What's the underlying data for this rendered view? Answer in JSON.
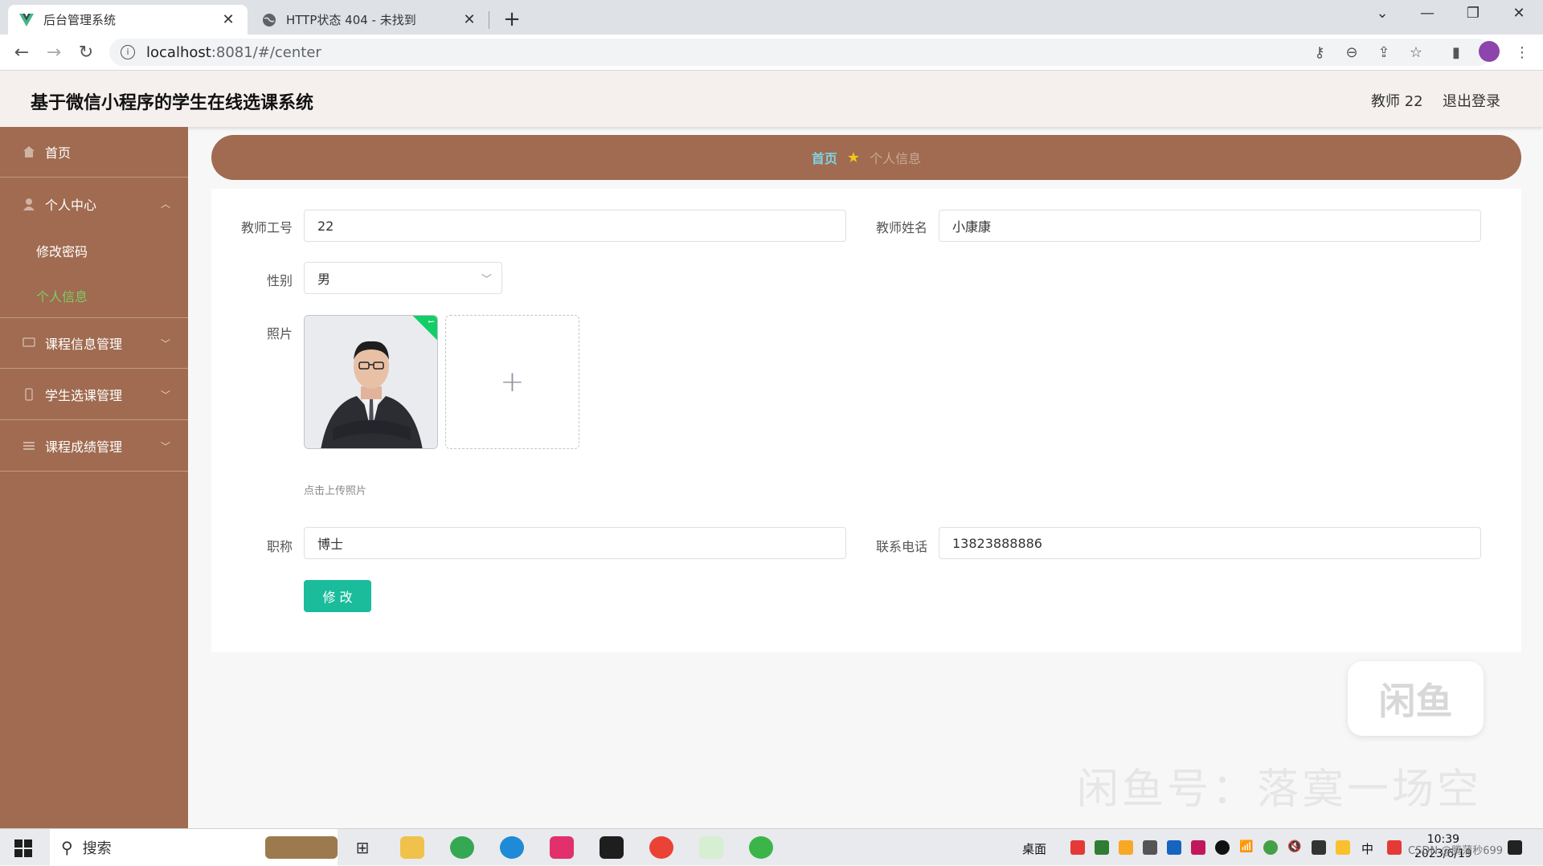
{
  "browser": {
    "tabs": [
      {
        "title": "后台管理系统",
        "active": true
      },
      {
        "title": "HTTP状态 404 - 未找到",
        "active": false
      }
    ],
    "url_host": "localhost",
    "url_path": ":8081/#/center"
  },
  "header": {
    "title": "基于微信小程序的学生在线选课系统",
    "user": "教师 22",
    "logout": "退出登录"
  },
  "sidebar": {
    "items": [
      {
        "label": "首页",
        "icon": "home-icon"
      },
      {
        "label": "个人中心",
        "icon": "user-icon"
      },
      {
        "label": "修改密码"
      },
      {
        "label": "个人信息"
      },
      {
        "label": "课程信息管理",
        "icon": "chat-icon"
      },
      {
        "label": "学生选课管理",
        "icon": "phone-icon"
      },
      {
        "label": "课程成绩管理",
        "icon": "menu-icon"
      }
    ]
  },
  "breadcrumb": {
    "home": "首页",
    "current": "个人信息"
  },
  "form": {
    "teacher_id_label": "教师工号",
    "teacher_id_value": "22",
    "teacher_name_label": "教师姓名",
    "teacher_name_value": "小康康",
    "gender_label": "性别",
    "gender_value": "男",
    "photo_label": "照片",
    "upload_tip": "点击上传照片",
    "title_label": "职称",
    "title_value": "博士",
    "phone_label": "联系电话",
    "phone_value": "13823888886",
    "submit_label": "修 改"
  },
  "watermark": {
    "logo": "闲鱼",
    "text": "闲鱼号：落寞一场空"
  },
  "taskbar": {
    "search": "搜索",
    "desktop": "桌面",
    "ime": "中",
    "time": "10:39",
    "date": "2023/6/19",
    "csdn": "CSDN @腾蒲秒699"
  },
  "colors": {
    "sidebar": "#a06b50",
    "active_sub": "#7ecb63",
    "crumb_home": "#7fd3e6",
    "button": "#1abc9c"
  }
}
